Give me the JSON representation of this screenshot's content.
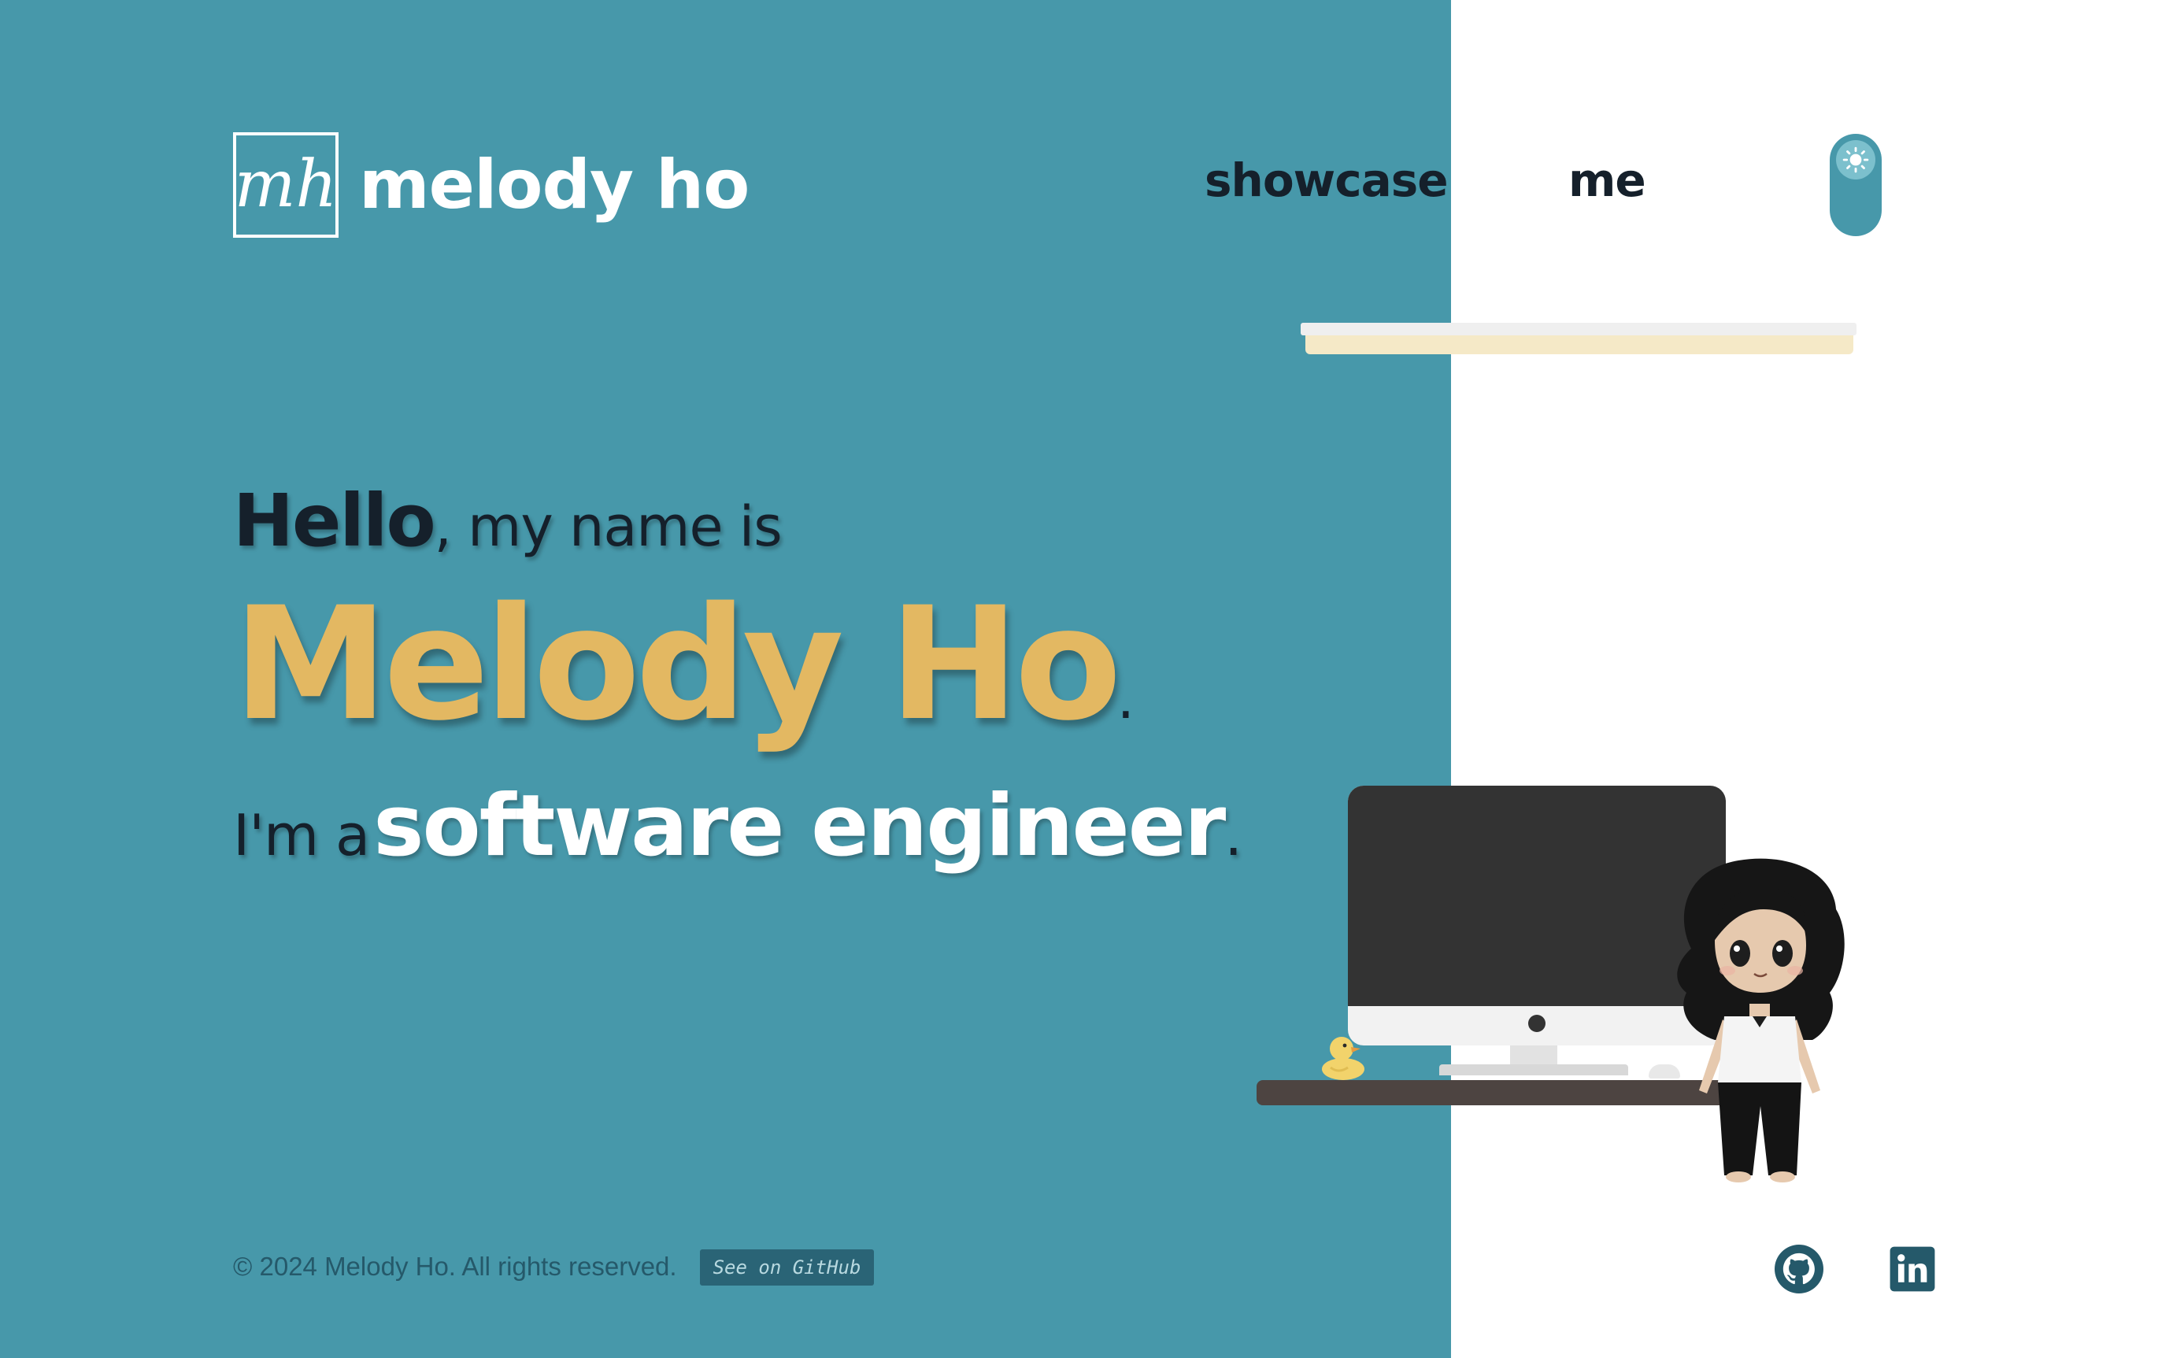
{
  "header": {
    "logo_monogram": "mh",
    "logo_text": "melody ho",
    "nav": [
      {
        "label": "showcase"
      },
      {
        "label": "me"
      }
    ],
    "theme_toggle": {
      "icon": "sun-icon"
    }
  },
  "hero": {
    "greeting_bold": "Hello",
    "greeting_rest": ", my name is",
    "name": "Melody Ho",
    "name_period": ".",
    "role_prefix": "I'm a",
    "role": "software engineer",
    "role_period": "."
  },
  "footer": {
    "copyright": "© 2024 Melody Ho. All rights reserved.",
    "github_badge": "See on GitHub",
    "social": [
      {
        "icon": "github-icon"
      },
      {
        "icon": "linkedin-icon"
      }
    ]
  },
  "colors": {
    "teal_background": "#4798aa",
    "accent_gold": "#e3b862",
    "text_dark": "#15202b",
    "footer_text": "#25596a",
    "badge_background": "#2a6476"
  }
}
